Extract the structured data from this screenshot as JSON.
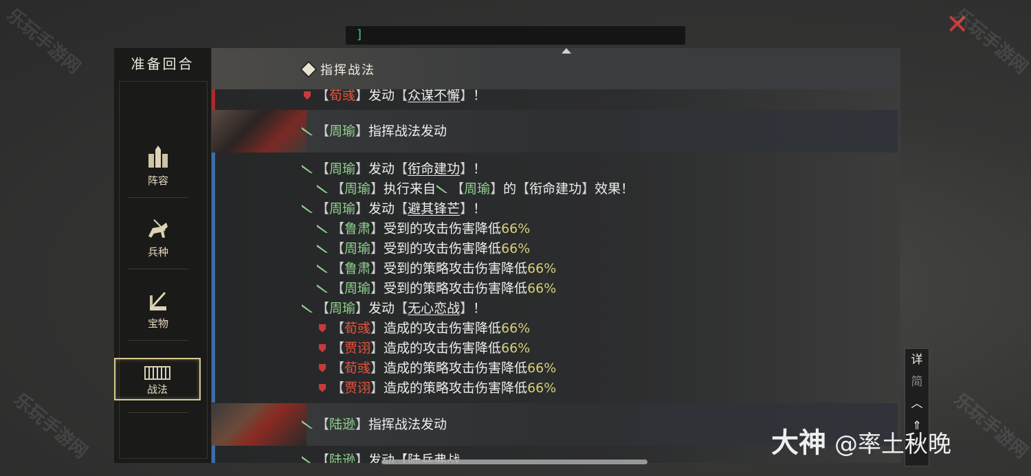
{
  "top_input": {
    "text": "]"
  },
  "watermark": "乐玩手游网",
  "sidebar": {
    "title": "准备回合",
    "items": [
      {
        "label": "阵容",
        "icon": "troops-icon"
      },
      {
        "label": "兵种",
        "icon": "cavalry-icon"
      },
      {
        "label": "宝物",
        "icon": "treasure-icon"
      },
      {
        "label": "战法",
        "icon": "tactics-icon",
        "active": true
      }
    ]
  },
  "section": {
    "title": "指挥战法"
  },
  "log": {
    "first_line": {
      "name": "荀彧",
      "verb": "发动",
      "skill": "众谋不懈",
      "end": "！"
    },
    "zhouyu_head": {
      "name": "周瑜",
      "text": "指挥战法发动"
    },
    "lines": [
      {
        "name": "周瑜",
        "pre": "发动",
        "skill": "衔命建功",
        "post": "！"
      },
      {
        "name": "周瑜",
        "pre": "执行来自",
        "name2": "周瑜",
        "mid": "的",
        "skill": "衔命建功",
        "post": "效果！"
      },
      {
        "name": "周瑜",
        "pre": "发动",
        "skill": "避其锋芒",
        "post": "！"
      },
      {
        "name": "鲁肃",
        "text": "受到的攻击伤害降低",
        "num": "66%"
      },
      {
        "name": "周瑜",
        "text": "受到的攻击伤害降低",
        "num": "66%"
      },
      {
        "name": "鲁肃",
        "text": "受到的策略攻击伤害降低",
        "num": "66%"
      },
      {
        "name": "周瑜",
        "text": "受到的策略攻击伤害降低",
        "num": "66%"
      },
      {
        "name": "周瑜",
        "pre": "发动",
        "skill": "无心恋战",
        "post": "！"
      },
      {
        "name": "荀彧",
        "text": "造成的攻击伤害降低",
        "num": "66%"
      },
      {
        "name": "贾诩",
        "text": "造成的攻击伤害降低",
        "num": "66%"
      },
      {
        "name": "荀彧",
        "text": "造成的策略攻击伤害降低",
        "num": "66%"
      },
      {
        "name": "贾诩",
        "text": "造成的策略攻击伤害降低",
        "num": "66%"
      }
    ],
    "luxun_head": {
      "name": "陆逊",
      "text": "指挥战法发动"
    },
    "luxun_partial": {
      "name": "陆逊",
      "text": "发动【",
      "skill": "陆兵弗战"
    }
  },
  "detail_buttons": {
    "detail": "详",
    "simple": "简"
  },
  "brand": {
    "logo": "大神",
    "handle": "@率土秋晚"
  },
  "colors": {
    "ally_name": "#8fd38e",
    "enemy_name": "#e9533e",
    "number": "#d8d07a",
    "active_border": "#d8c992"
  }
}
